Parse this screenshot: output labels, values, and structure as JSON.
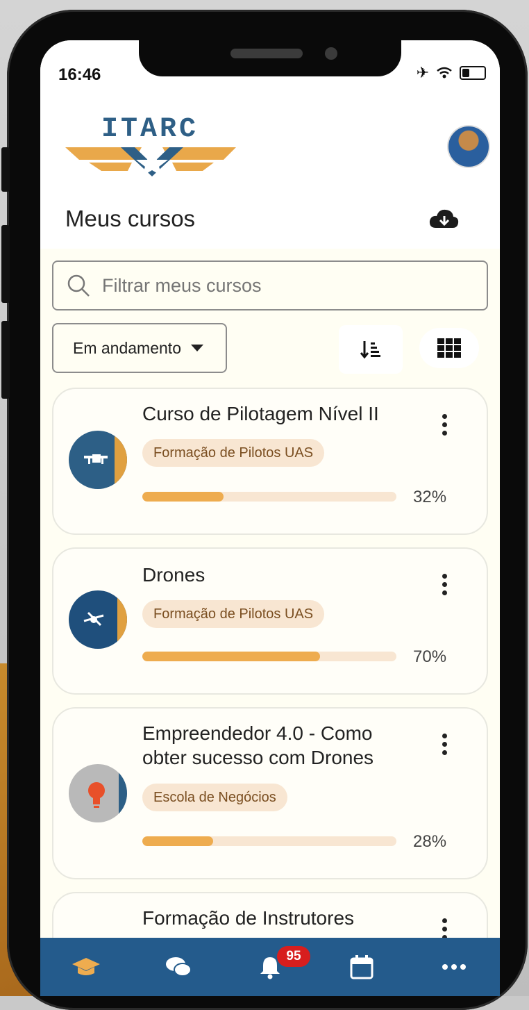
{
  "status": {
    "time": "16:46"
  },
  "brand": {
    "logo_text": "ITARC"
  },
  "header": {
    "title": "Meus cursos"
  },
  "search": {
    "placeholder": "Filtrar meus cursos"
  },
  "filter": {
    "selected": "Em andamento"
  },
  "courses": [
    {
      "title": "Curso de Pilotagem Nível II",
      "category": "Formação de Pilotos UAS",
      "progress": 32,
      "progress_label": "32%"
    },
    {
      "title": "Drones",
      "category": "Formação de Pilotos UAS",
      "progress": 70,
      "progress_label": "70%"
    },
    {
      "title": "Empreendedor 4.0 - Como obter sucesso com Drones",
      "category": "Escola de Negócios",
      "progress": 28,
      "progress_label": "28%"
    },
    {
      "title": "Formação de Instrutores"
    }
  ],
  "tabbar": {
    "notifications_count": "95"
  },
  "colors": {
    "accent": "#eeac4f",
    "nav": "#245b8c",
    "badge": "#d71e1e",
    "chip": "#f8e6d2"
  }
}
